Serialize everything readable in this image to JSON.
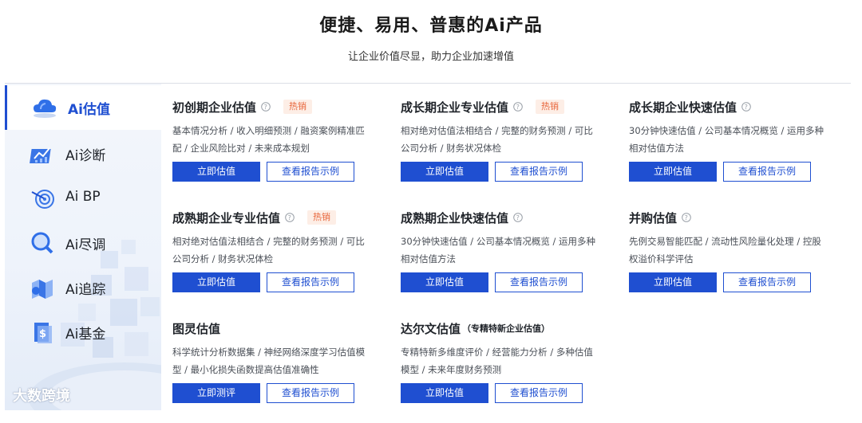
{
  "header": {
    "title": "便捷、易用、普惠的Ai产品",
    "subtitle": "让企业价值尽显，助力企业加速增值"
  },
  "sidebar": {
    "items": [
      {
        "label": "Ai估值",
        "icon": "cloud-icon",
        "active": true
      },
      {
        "label": "Ai诊断",
        "icon": "chart-icon",
        "active": false
      },
      {
        "label": "Ai BP",
        "icon": "target-icon",
        "active": false
      },
      {
        "label": "Ai尽调",
        "icon": "magnifier-icon",
        "active": false
      },
      {
        "label": "Ai追踪",
        "icon": "map-icon",
        "active": false
      },
      {
        "label": "Ai基金",
        "icon": "fund-icon",
        "active": false
      }
    ],
    "watermark": "大数跨境"
  },
  "cards": [
    {
      "title": "初创期企业估值",
      "subtitle": "",
      "hot": "热销",
      "desc": "基本情况分析 / 收入明细预测 / 融资案例精准匹配 / 企业风险比对 / 未来成本规划",
      "primary": "立即估值",
      "secondary": "查看报告示例"
    },
    {
      "title": "成长期企业专业估值",
      "subtitle": "",
      "hot": "热销",
      "desc": "相对绝对估值法相结合 / 完整的财务预测 / 可比公司分析 / 财务状况体检",
      "primary": "立即估值",
      "secondary": "查看报告示例"
    },
    {
      "title": "成长期企业快速估值",
      "subtitle": "",
      "hot": "",
      "desc": "30分钟快速估值 / 公司基本情况概览 / 运用多种相对估值方法",
      "primary": "立即估值",
      "secondary": "查看报告示例"
    },
    {
      "title": "成熟期企业专业估值",
      "subtitle": "",
      "hot": "热销",
      "desc": "相对绝对估值法相结合 / 完整的财务预测 / 可比公司分析 / 财务状况体检",
      "primary": "立即估值",
      "secondary": "查看报告示例"
    },
    {
      "title": "成熟期企业快速估值",
      "subtitle": "",
      "hot": "",
      "desc": "30分钟快速估值 / 公司基本情况概览 / 运用多种相对估值方法",
      "primary": "立即估值",
      "secondary": "查看报告示例"
    },
    {
      "title": "并购估值",
      "subtitle": "",
      "hot": "",
      "desc": "先例交易智能匹配 / 流动性风险量化处理 / 控股权溢价科学评估",
      "primary": "立即估值",
      "secondary": "查看报告示例"
    },
    {
      "title": "图灵估值",
      "subtitle": "",
      "hot": "",
      "desc": "科学统计分析数据集 / 神经网络深度学习估值模型 / 最小化损失函数提高估值准确性",
      "primary": "立即测评",
      "secondary": "查看报告示例"
    },
    {
      "title": "达尔文估值",
      "subtitle": "（专精特新企业估值）",
      "hot": "",
      "desc": "专精特新多维度评价 / 经营能力分析 / 多种估值模型 / 未来年度财务预测",
      "primary": "立即估值",
      "secondary": "查看报告示例"
    }
  ],
  "colors": {
    "accent": "#1f4fd1",
    "hot_bg": "#fdeee6",
    "hot_text": "#e8663b"
  }
}
